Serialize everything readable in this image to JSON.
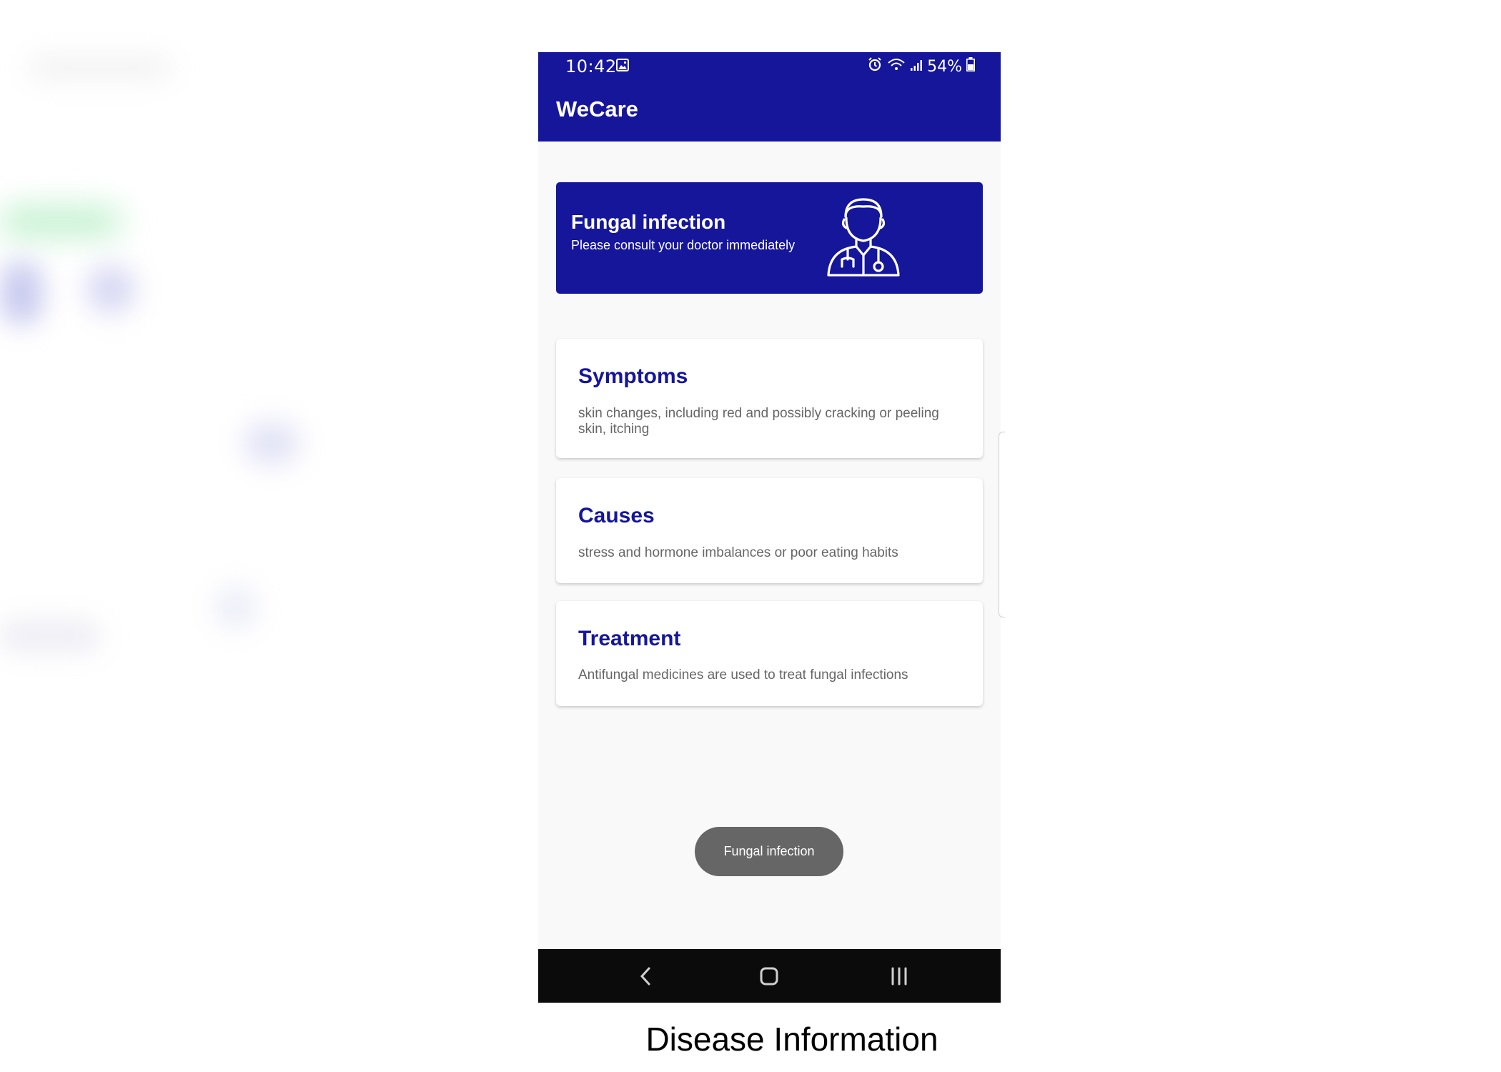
{
  "status_bar": {
    "time": "10:42",
    "battery": "54%"
  },
  "app": {
    "title": "WeCare",
    "theme_color": "#15169a"
  },
  "banner": {
    "title": "Fungal infection",
    "subtitle": "Please consult your doctor immediately",
    "icon": "doctor-icon"
  },
  "cards": {
    "symptoms": {
      "title": "Symptoms",
      "text": " skin changes, including red and possibly cracking or peeling skin, itching"
    },
    "causes": {
      "title": "Causes",
      "text": " stress and hormone imbalances or poor eating habits"
    },
    "treatment": {
      "title": "Treatment",
      "text": "Antifungal medicines are used to treat fungal infections"
    }
  },
  "toast": {
    "text": "Fungal infection"
  },
  "navigation": {
    "icons": [
      "back-icon",
      "home-icon",
      "recents-icon"
    ]
  },
  "caption": "Disease Information"
}
